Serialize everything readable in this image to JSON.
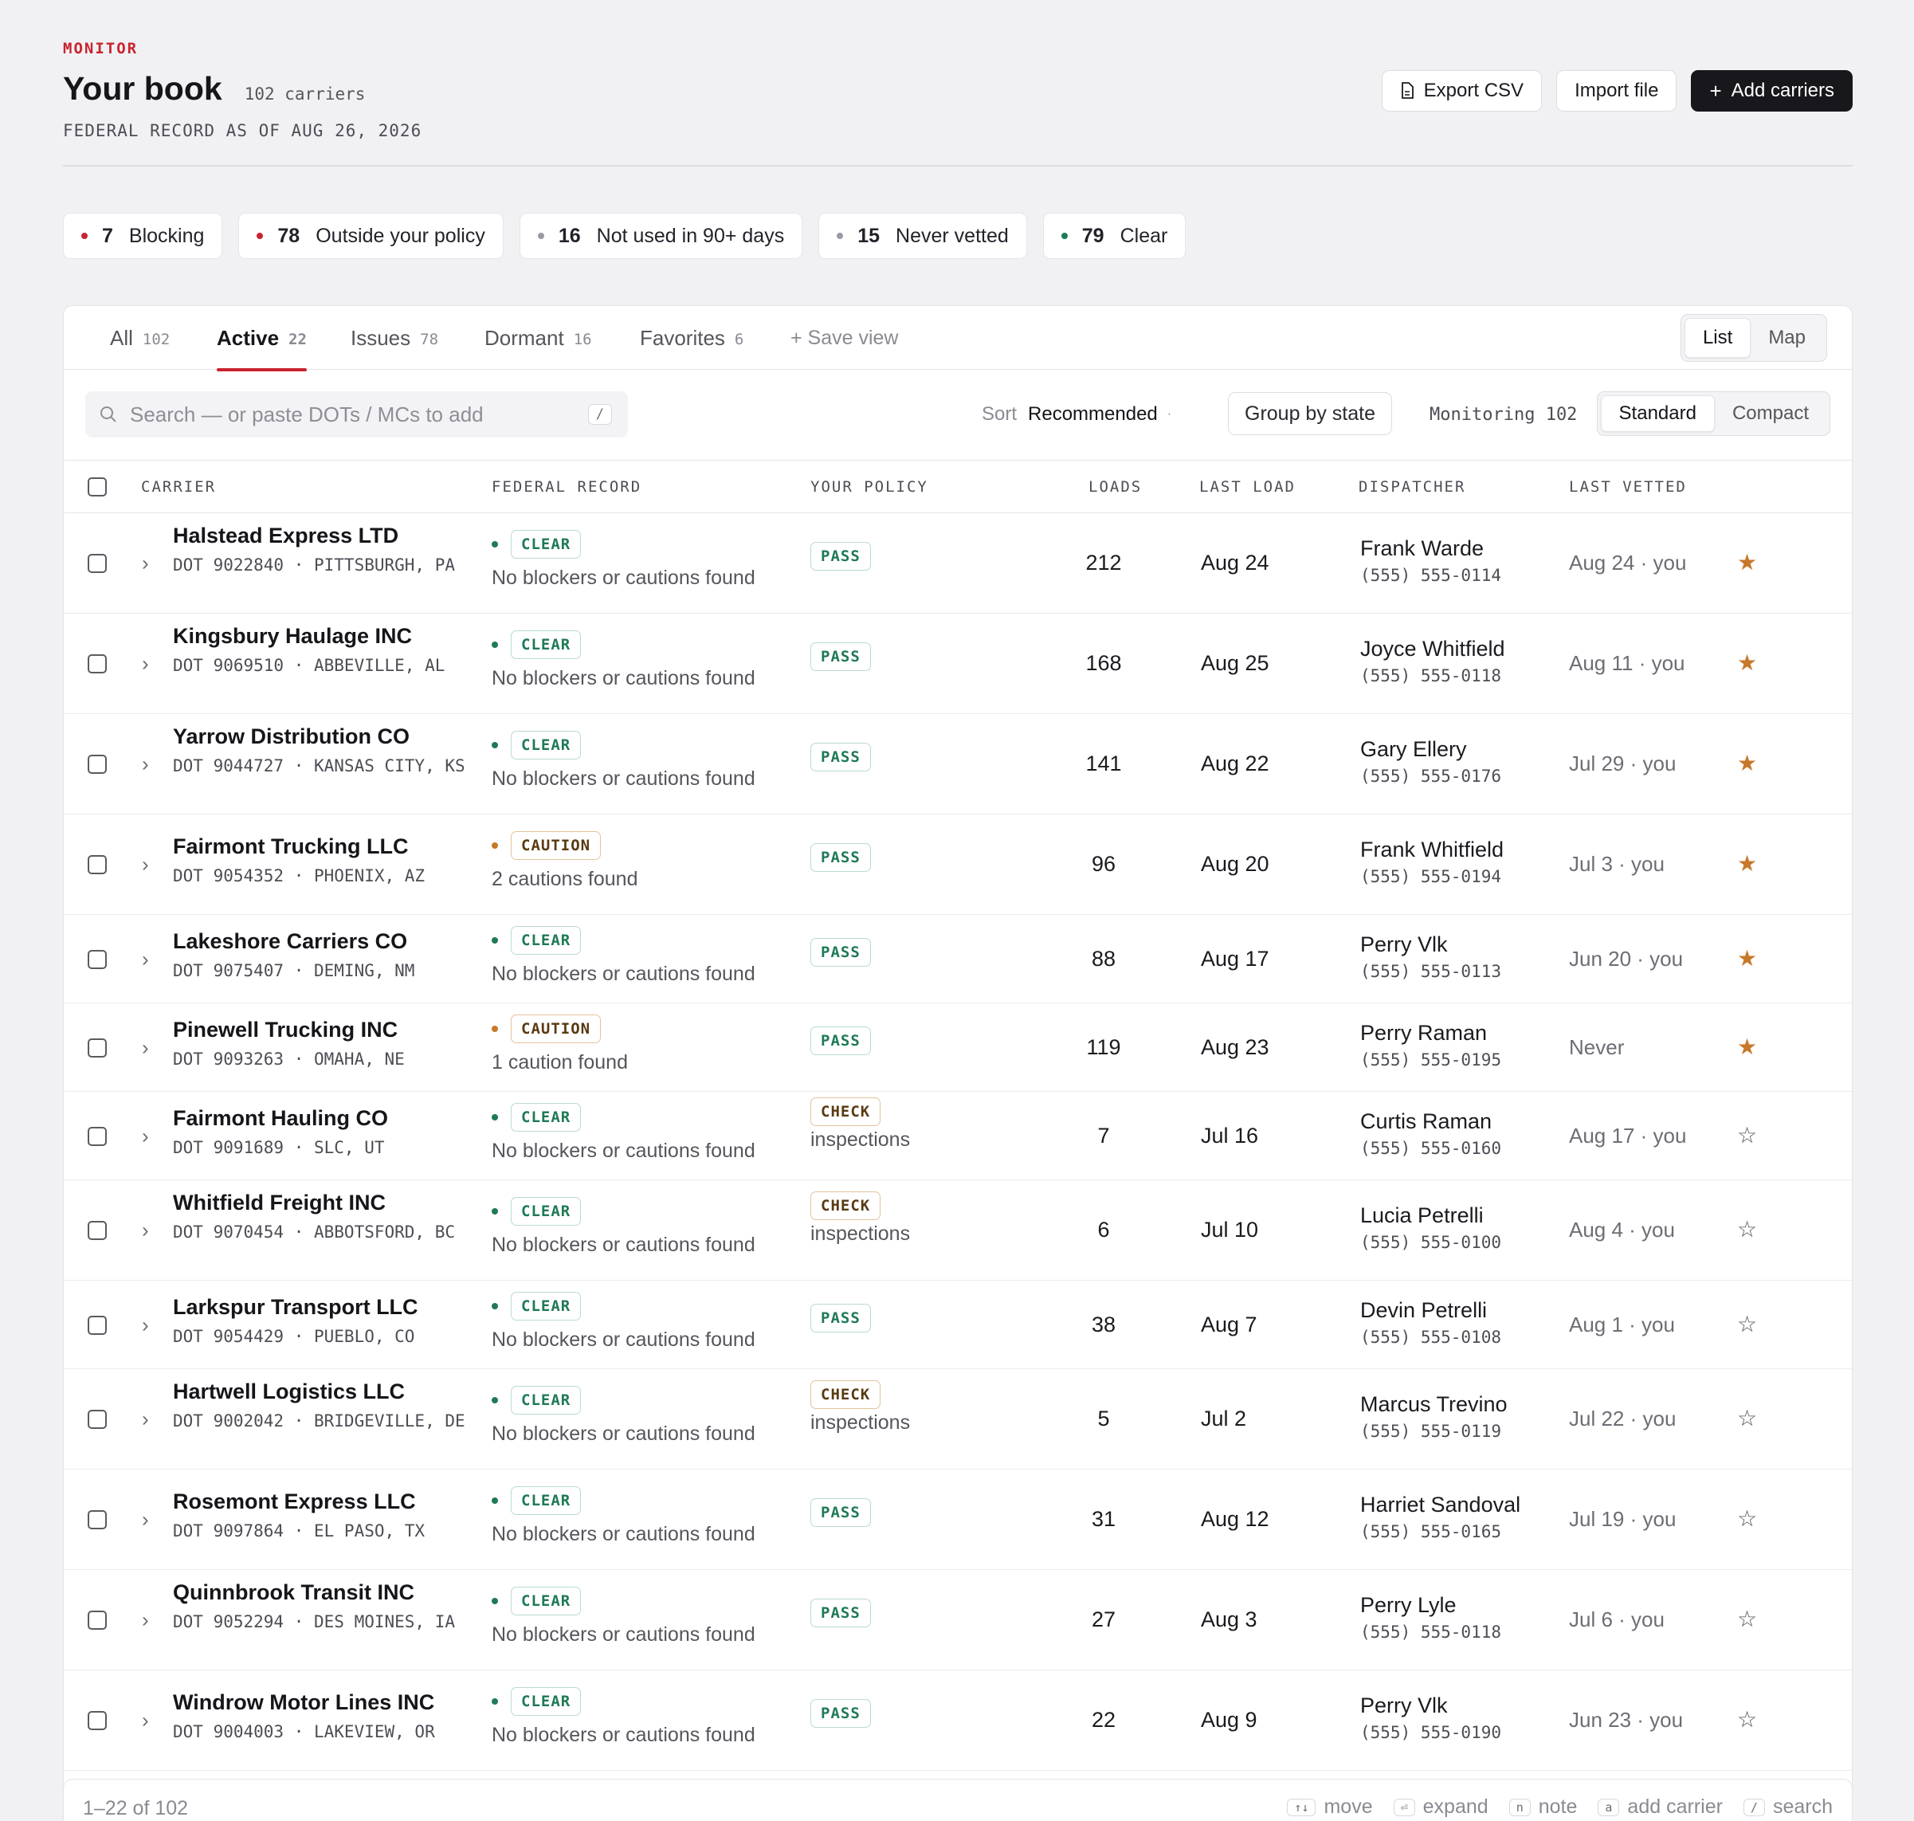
{
  "header": {
    "eyebrow": "MONITOR",
    "title": "Your book",
    "carrier_count": "102 carriers",
    "record_as_of": "FEDERAL RECORD AS OF AUG 26, 2026",
    "export_label": "Export CSV",
    "import_label": "Import file",
    "add_label": "Add carriers"
  },
  "summary_chips": [
    {
      "count": "7",
      "label": "Blocking",
      "dot_color": "#c8242f"
    },
    {
      "count": "78",
      "label": "Outside your policy",
      "dot_color": "#c8242f"
    },
    {
      "count": "16",
      "label": "Not used in 90+ days",
      "dot_color": "#9a9aa2"
    },
    {
      "count": "15",
      "label": "Never vetted",
      "dot_color": "#9a9aa2"
    },
    {
      "count": "79",
      "label": "Clear",
      "dot_color": "#1f7a55"
    }
  ],
  "tabs": [
    {
      "label": "All",
      "count": "102"
    },
    {
      "label": "Active",
      "count": "22"
    },
    {
      "label": "Issues",
      "count": "78"
    },
    {
      "label": "Dormant",
      "count": "16"
    },
    {
      "label": "Favorites",
      "count": "6"
    }
  ],
  "save_view_label": "+ Save view",
  "view_toggle": {
    "list": "List",
    "map": "Map"
  },
  "toolbar": {
    "search_placeholder": "Search — or paste DOTs / MCs to add",
    "search_shortcut": "/",
    "sort_label": "Sort",
    "sort_value": "Recommended",
    "group_label": "Group by state",
    "monitoring": "Monitoring 102",
    "density_standard": "Standard",
    "density_compact": "Compact"
  },
  "columns": {
    "carrier": "CARRIER",
    "federal": "FEDERAL RECORD",
    "policy": "YOUR POLICY",
    "loads": "LOADS",
    "last_load": "LAST LOAD",
    "dispatcher": "DISPATCHER",
    "last_vetted": "LAST VETTED"
  },
  "rows": [
    {
      "name": "Halstead Express LTD",
      "meta": "DOT 9022840  ·  PITTSBURGH, PA",
      "fed": "CLEAR",
      "fed_note": "No blockers or cautions found",
      "policy": "PASS",
      "policy_note": "",
      "loads": "212",
      "last_load": "Aug 24",
      "dispatcher": "Frank Warde",
      "phone": "(555) 555-0114",
      "vetted": "Aug 24 · you",
      "fav": true
    },
    {
      "name": "Kingsbury Haulage INC",
      "meta": "DOT 9069510  ·  ABBEVILLE, AL",
      "fed": "CLEAR",
      "fed_note": "No blockers or cautions found",
      "policy": "PASS",
      "policy_note": "",
      "loads": "168",
      "last_load": "Aug 25",
      "dispatcher": "Joyce Whitfield",
      "phone": "(555) 555-0118",
      "vetted": "Aug 11 · you",
      "fav": true
    },
    {
      "name": "Yarrow Distribution CO",
      "meta": "DOT 9044727  ·  KANSAS CITY, KS",
      "fed": "CLEAR",
      "fed_note": "No blockers or cautions found",
      "policy": "PASS",
      "policy_note": "",
      "loads": "141",
      "last_load": "Aug 22",
      "dispatcher": "Gary Ellery",
      "phone": "(555) 555-0176",
      "vetted": "Jul 29 · you",
      "fav": true
    },
    {
      "name": "Fairmont Trucking LLC",
      "meta": "DOT 9054352  ·  PHOENIX, AZ",
      "fed": "CAUTION",
      "fed_note": "2 cautions found",
      "policy": "PASS",
      "policy_note": "",
      "loads": "96",
      "last_load": "Aug 20",
      "dispatcher": "Frank Whitfield",
      "phone": "(555) 555-0194",
      "vetted": "Jul 3 · you",
      "fav": true
    },
    {
      "name": "Lakeshore Carriers CO",
      "meta": "DOT 9075407  ·  DEMING, NM",
      "fed": "CLEAR",
      "fed_note": "No blockers or cautions found",
      "policy": "PASS",
      "policy_note": "",
      "loads": "88",
      "last_load": "Aug 17",
      "dispatcher": "Perry Vlk",
      "phone": "(555) 555-0113",
      "vetted": "Jun 20 · you",
      "fav": true
    },
    {
      "name": "Pinewell Trucking INC",
      "meta": "DOT 9093263  ·  OMAHA, NE",
      "fed": "CAUTION",
      "fed_note": "1 caution found",
      "policy": "PASS",
      "policy_note": "",
      "loads": "119",
      "last_load": "Aug 23",
      "dispatcher": "Perry Raman",
      "phone": "(555) 555-0195",
      "vetted": "Never",
      "fav": true
    },
    {
      "name": "Fairmont Hauling CO",
      "meta": "DOT 9091689  ·  SLC, UT",
      "fed": "CLEAR",
      "fed_note": "No blockers or cautions found",
      "policy": "CHECK",
      "policy_note": "inspections",
      "loads": "7",
      "last_load": "Jul 16",
      "dispatcher": "Curtis Raman",
      "phone": "(555) 555-0160",
      "vetted": "Aug 17 · you",
      "fav": false
    },
    {
      "name": "Whitfield Freight INC",
      "meta": "DOT 9070454  ·  ABBOTSFORD, BC",
      "fed": "CLEAR",
      "fed_note": "No blockers or cautions found",
      "policy": "CHECK",
      "policy_note": "inspections",
      "loads": "6",
      "last_load": "Jul 10",
      "dispatcher": "Lucia Petrelli",
      "phone": "(555) 555-0100",
      "vetted": "Aug 4 · you",
      "fav": false
    },
    {
      "name": "Larkspur Transport LLC",
      "meta": "DOT 9054429  ·  PUEBLO, CO",
      "fed": "CLEAR",
      "fed_note": "No blockers or cautions found",
      "policy": "PASS",
      "policy_note": "",
      "loads": "38",
      "last_load": "Aug 7",
      "dispatcher": "Devin Petrelli",
      "phone": "(555) 555-0108",
      "vetted": "Aug 1 · you",
      "fav": false
    },
    {
      "name": "Hartwell Logistics LLC",
      "meta": "DOT 9002042  ·  BRIDGEVILLE, DE",
      "fed": "CLEAR",
      "fed_note": "No blockers or cautions found",
      "policy": "CHECK",
      "policy_note": "inspections",
      "loads": "5",
      "last_load": "Jul 2",
      "dispatcher": "Marcus Trevino",
      "phone": "(555) 555-0119",
      "vetted": "Jul 22 · you",
      "fav": false
    },
    {
      "name": "Rosemont Express LLC",
      "meta": "DOT 9097864  ·  EL PASO, TX",
      "fed": "CLEAR",
      "fed_note": "No blockers or cautions found",
      "policy": "PASS",
      "policy_note": "",
      "loads": "31",
      "last_load": "Aug 12",
      "dispatcher": "Harriet Sandoval",
      "phone": "(555) 555-0165",
      "vetted": "Jul 19 · you",
      "fav": false
    },
    {
      "name": "Quinnbrook Transit INC",
      "meta": "DOT 9052294  ·  DES MOINES, IA",
      "fed": "CLEAR",
      "fed_note": "No blockers or cautions found",
      "policy": "PASS",
      "policy_note": "",
      "loads": "27",
      "last_load": "Aug 3",
      "dispatcher": "Perry Lyle",
      "phone": "(555) 555-0118",
      "vetted": "Jul 6 · you",
      "fav": false
    },
    {
      "name": "Windrow Motor Lines INC",
      "meta": "DOT 9004003  ·  LAKEVIEW, OR",
      "fed": "CLEAR",
      "fed_note": "No blockers or cautions found",
      "policy": "PASS",
      "policy_note": "",
      "loads": "22",
      "last_load": "Aug 9",
      "dispatcher": "Perry Vlk",
      "phone": "(555) 555-0190",
      "vetted": "Jun 23 · you",
      "fav": false
    }
  ],
  "footer": {
    "range": "1–22 of 102",
    "hints": [
      {
        "key": "↑↓",
        "label": "move"
      },
      {
        "key": "⏎",
        "label": "expand"
      },
      {
        "key": "n",
        "label": "note"
      },
      {
        "key": "a",
        "label": "add carrier"
      },
      {
        "key": "/",
        "label": "search"
      }
    ]
  },
  "colors": {
    "accent_red": "#c8242f",
    "clear_green": "#1f7a55",
    "caution_amber": "#c8782a",
    "favorite_star": "#c8782a"
  }
}
